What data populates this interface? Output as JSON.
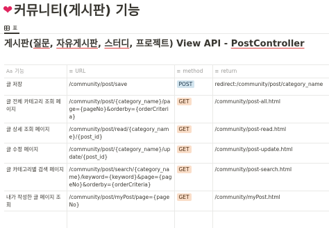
{
  "page": {
    "title": "커뮤니티(게시판) 기능",
    "title_icon": "red-heart"
  },
  "view_tab": {
    "label": "표",
    "icon": "table-icon"
  },
  "database": {
    "title_parts": [
      "게시판(",
      "질문",
      ", ",
      "자유게시판",
      ", ",
      "스터디",
      ", 프로젝트) View API - ",
      "PostController"
    ]
  },
  "columns": [
    {
      "icon_glyph": "Aa",
      "label": "기능"
    },
    {
      "icon_glyph": "≡",
      "label": "URL"
    },
    {
      "icon_glyph": "≡",
      "label": "method"
    },
    {
      "icon_glyph": "≡",
      "label": "return"
    }
  ],
  "rows": [
    {
      "feature": "글 저장",
      "url": "/community/post/save",
      "method": "POST",
      "return": "redirect:/community/post/category_name"
    },
    {
      "feature": "글 전체 카테고리 조회 페이지",
      "url": "/community/post/{category_name}/page={pageNo}&orderby={orderCriteria}",
      "method": "GET",
      "return": "/community/post-all.html"
    },
    {
      "feature": "글 상세 조회 페이지",
      "url": "/community/post/read/{category_name}/{post_id}",
      "method": "GET",
      "return": "/community/post-read.html"
    },
    {
      "feature": "글 수정 페이지",
      "url": "/community/post/{category_name}/update/{post_id}",
      "method": "GET",
      "return": "/community/post-update.html"
    },
    {
      "feature": "글 카테고리별 검색 페이지",
      "url": "/community/post/search/{category_name}/keyword={keyword}&page={pageNo}&orderby={orderCriteria}",
      "method": "GET",
      "return": "/community/post-search.html"
    },
    {
      "feature": "내가 작성한 글 페이지 조회",
      "url": "/community/post/myPost/page={pageNo}",
      "method": "GET",
      "return": "/community/myPost.html"
    }
  ],
  "colors": {
    "post_badge_bg": "#d3e5ef",
    "get_badge_bg": "#fadec9",
    "heart": "#e0245e",
    "title_underline": "#e03e3e"
  }
}
